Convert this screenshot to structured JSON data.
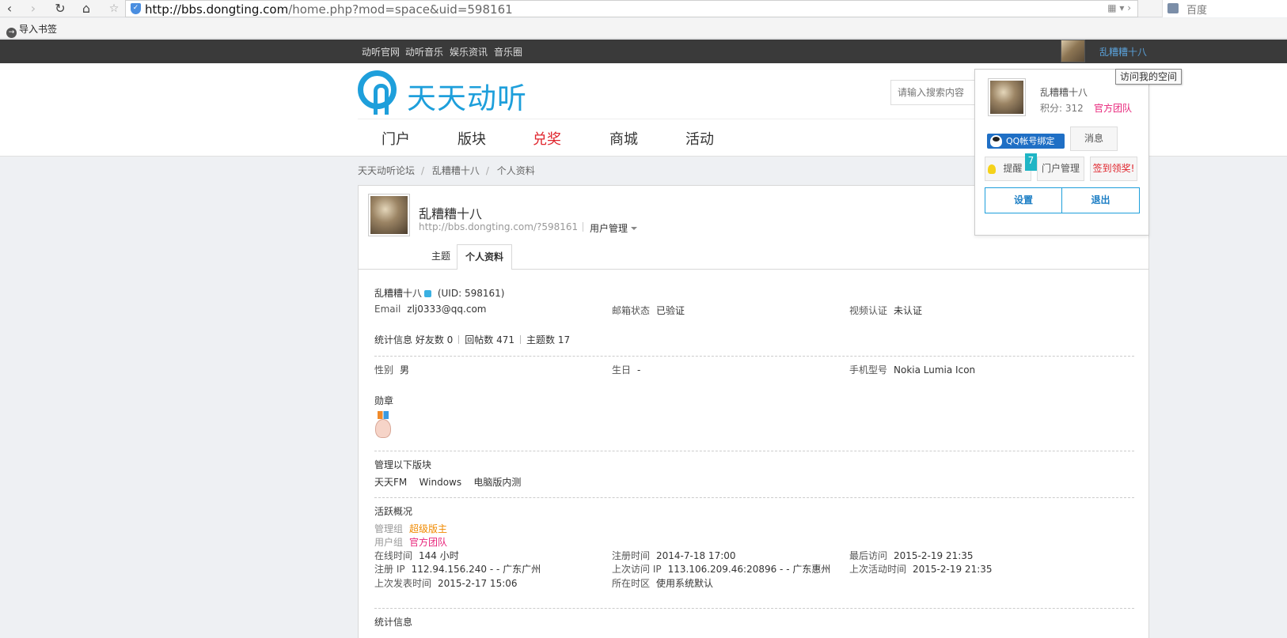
{
  "browser": {
    "back_icon": "back-arrow-icon",
    "forward_icon": "forward-arrow-icon",
    "reload_icon": "reload-icon",
    "home_icon": "home-icon",
    "star_icon": "star-icon",
    "url_host": "http://bbs.dongting.com",
    "url_path": "/home.php?mod=space&uid=598161",
    "search_engine": "百度",
    "bookmark_import": "导入书签"
  },
  "topbar": {
    "links": [
      "动听官网",
      "动听音乐",
      "娱乐资讯",
      "音乐圈"
    ],
    "username": "乱糟糟十八",
    "tooltip": "访问我的空间"
  },
  "header": {
    "logo_text": "天天动听",
    "search_placeholder": "请输入搜索内容",
    "nav": [
      "门户",
      "版块",
      "兑奖",
      "商城",
      "活动"
    ]
  },
  "breadcrumb": [
    "天天动听论坛",
    "乱糟糟十八",
    "个人资料"
  ],
  "profile": {
    "name": "乱糟糟十八",
    "url": "http://bbs.dongting.com/?598161",
    "manage_label": "用户管理",
    "tabs": [
      "主题",
      "个人资料"
    ]
  },
  "details": {
    "name": "乱糟糟十八",
    "uid": "(UID: 598161)",
    "email_label": "Email",
    "email": "zlj0333@qq.com",
    "email_status_label": "邮箱状态",
    "email_status": "已验证",
    "video_label": "视频认证",
    "video_status": "未认证",
    "stats_label": "统计信息",
    "friends": "好友数 0",
    "replies": "回帖数 471",
    "threads": "主题数 17",
    "gender_label": "性别",
    "gender": "男",
    "birthday_label": "生日",
    "birthday": "-",
    "phone_label": "手机型号",
    "phone": "Nokia Lumia Icon",
    "medals_label": "勋章",
    "manage_label": "管理以下版块",
    "forums": [
      "天天FM",
      "Windows",
      "电脑版内测"
    ],
    "activity_label": "活跃概况",
    "admin_group_label": "管理组",
    "admin_group": "超级版主",
    "user_group_label": "用户组",
    "user_group": "官方团队",
    "online_label": "在线时间",
    "online": "144 小时",
    "reg_time_label": "注册时间",
    "reg_time": "2014-7-18 17:00",
    "last_visit_label": "最后访问",
    "last_visit": "2015-2-19 21:35",
    "reg_ip_label": "注册 IP",
    "reg_ip": "112.94.156.240 - - 广东广州",
    "last_ip_label": "上次访问 IP",
    "last_ip": "113.106.209.46:20896 - - 广东惠州",
    "last_active_label": "上次活动时间",
    "last_active": "2015-2-19 21:35",
    "last_post_label": "上次发表时间",
    "last_post": "2015-2-17 15:06",
    "timezone_label": "所在时区",
    "timezone": "使用系统默认",
    "stats2_label": "统计信息"
  },
  "user_panel": {
    "name": "乱糟糟十八",
    "points": "积分: 312",
    "team": "官方团队",
    "qq_bind": "QQ帐号绑定",
    "messages": "消息",
    "remind": "提醒",
    "remind_count": "7",
    "portal_manage": "门户管理",
    "sign_in": "签到领奖!",
    "settings": "设置",
    "logout": "退出"
  },
  "colors": {
    "brand": "#1e9fdb",
    "hot_nav": "#e0242c",
    "topbar": "#3a3a3a"
  }
}
